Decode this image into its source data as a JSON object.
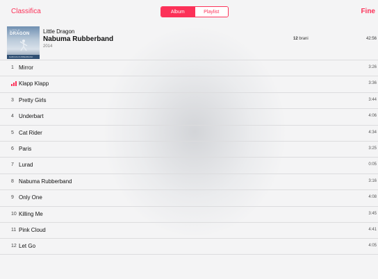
{
  "nav": {
    "back_label": "Classifica",
    "done_label": "Fine",
    "segments": [
      "Album",
      "Playlist"
    ],
    "selected_segment": "Album"
  },
  "album": {
    "artist": "Little Dragon",
    "title": "Nabuma Rubberband",
    "year": "2014",
    "track_count_num": "12",
    "track_count_unit": "brani",
    "total_duration": "42:56",
    "art_text_top": "LITTLE",
    "art_text_main": "DRAGON",
    "art_text_bottom": "NABUMA RUBBERBAND"
  },
  "tracks": [
    {
      "num": "1",
      "name": "Mirror",
      "duration": "3:26",
      "playing": false
    },
    {
      "num": "",
      "name": "Klapp Klapp",
      "duration": "3:36",
      "playing": true
    },
    {
      "num": "3",
      "name": "Pretty Girls",
      "duration": "3:44",
      "playing": false
    },
    {
      "num": "4",
      "name": "Underbart",
      "duration": "4:06",
      "playing": false
    },
    {
      "num": "5",
      "name": "Cat Rider",
      "duration": "4:34",
      "playing": false
    },
    {
      "num": "6",
      "name": "Paris",
      "duration": "3:25",
      "playing": false
    },
    {
      "num": "7",
      "name": "Lurad",
      "duration": "0:05",
      "playing": false
    },
    {
      "num": "8",
      "name": "Nabuma Rubberband",
      "duration": "3:16",
      "playing": false
    },
    {
      "num": "9",
      "name": "Only One",
      "duration": "4:08",
      "playing": false
    },
    {
      "num": "10",
      "name": "Killing Me",
      "duration": "3:45",
      "playing": false
    },
    {
      "num": "11",
      "name": "Pink Cloud",
      "duration": "4:41",
      "playing": false
    },
    {
      "num": "12",
      "name": "Let Go",
      "duration": "4:05",
      "playing": false
    }
  ],
  "colors": {
    "accent": "#fc3158"
  }
}
